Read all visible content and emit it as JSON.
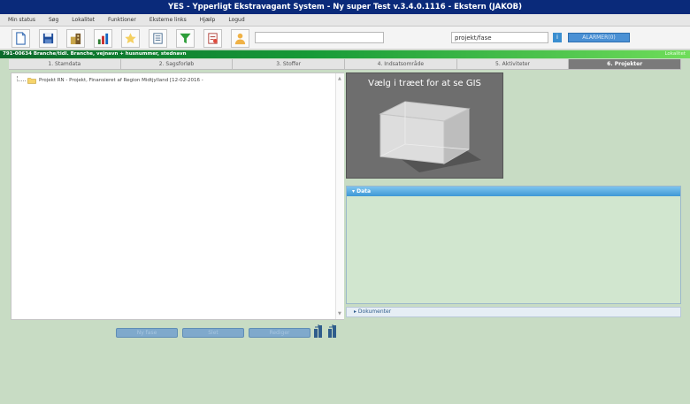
{
  "window": {
    "title": "YES - Ypperligt Ekstravagant System - Ny super Test v.3.4.0.1116 - Ekstern (JAKOB)"
  },
  "menu": {
    "items": [
      "Min status",
      "Søg",
      "Lokalitet",
      "Funktioner",
      "Eksterne links",
      "Hjælp",
      "Logud"
    ]
  },
  "toolbar": {
    "icons": [
      "new-document-icon",
      "save-icon",
      "building-icon",
      "chart-icon",
      "star-icon",
      "notepad-icon",
      "filter-icon",
      "document-edit-icon",
      "user-icon"
    ],
    "input_value": "",
    "search_value": "projekt/fase",
    "search_go_label": "i",
    "alarm_label": "ALARMER(0)"
  },
  "infobar": {
    "text": "791-00634 Branche/tidl. Branche, vejnavn + husnummer, stednavn",
    "right": "Lokalitet"
  },
  "tabs": [
    {
      "label": "1. Stamdata"
    },
    {
      "label": "2. Sagsforløb"
    },
    {
      "label": "3. Stoffer"
    },
    {
      "label": "4. Indsatsområde"
    },
    {
      "label": "5. Aktiviteter"
    },
    {
      "label": "6. Projekter"
    }
  ],
  "tree": {
    "node_label": "Projekt RN - Projekt, Finansieret af Region Midtjylland [12-02-2016 -"
  },
  "buttons": {
    "ny_fase": "Ny fase",
    "slet": "Slet",
    "rediger": "Rediger"
  },
  "gis": {
    "title": "Vælg i træet for at se GIS"
  },
  "data_panel": {
    "header": "▾ Data"
  },
  "docs_panel": {
    "header": "▸ Dokumenter"
  },
  "colors": {
    "titlebar": "#0a2a7a",
    "infobar_start": "#0b6a2b",
    "infobar_end": "#6fdd5a",
    "active_tab": "#7a7a7a",
    "background": "#c8dcc4",
    "data_header": "#3e98d6"
  }
}
